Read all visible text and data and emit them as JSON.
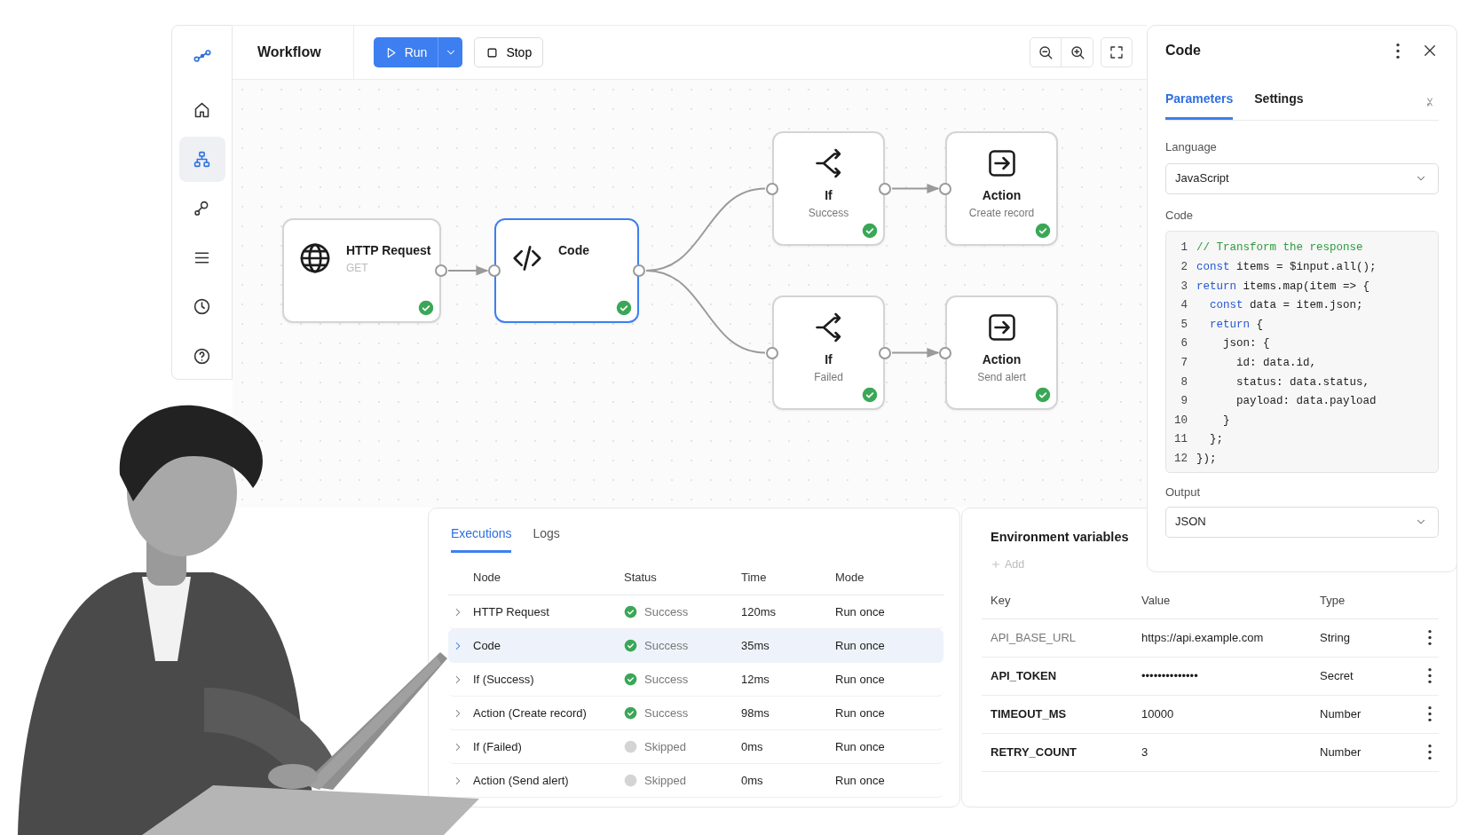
{
  "sidebar": {
    "items": [
      {
        "selected": false
      },
      {
        "selected": true
      },
      {
        "selected": false
      },
      {
        "selected": false
      },
      {
        "selected": false
      },
      {
        "selected": false
      }
    ]
  },
  "toolbar": {
    "title": "Workflow",
    "run_button": "Run",
    "stop_button": "Stop"
  },
  "canvas": {
    "nodes": [
      {
        "kind": "http",
        "title": "HTTP Request",
        "subtitle": "GET",
        "selected": false,
        "succeeded": true
      },
      {
        "kind": "code",
        "title": "Code",
        "selected": true,
        "succeeded": true
      },
      {
        "kind": "if",
        "title": "If",
        "subtitle": "Success",
        "selected": false,
        "succeeded": true
      },
      {
        "kind": "action",
        "title": "Action",
        "subtitle": "Create record",
        "selected": false,
        "succeeded": true
      },
      {
        "kind": "if",
        "title": "If",
        "subtitle": "Failed",
        "selected": false,
        "succeeded": true
      },
      {
        "kind": "action",
        "title": "Action",
        "subtitle": "Send alert",
        "selected": false,
        "succeeded": true
      }
    ]
  },
  "panel": {
    "title": "Code",
    "tabs": [
      {
        "label": "Parameters",
        "selected": true
      },
      {
        "label": "Settings",
        "selected": false
      }
    ],
    "language_label": "Language",
    "language": "JavaScript",
    "code_label": "Code",
    "code_lines": [
      {
        "number": "1",
        "tokens": [
          {
            "kind": "comment",
            "text": "// Transform the response"
          }
        ]
      },
      {
        "number": "2",
        "tokens": [
          {
            "kind": "keyword",
            "text": "const"
          },
          {
            "kind": "plain",
            "text": " items = $input.all();"
          }
        ]
      },
      {
        "number": "3",
        "tokens": [
          {
            "kind": "keyword",
            "text": "return"
          },
          {
            "kind": "plain",
            "text": " items.map(item => {"
          }
        ]
      },
      {
        "number": "4",
        "tokens": [
          {
            "kind": "keyword",
            "text": "  const"
          },
          {
            "kind": "plain",
            "text": " data = item.json;"
          }
        ]
      },
      {
        "number": "5",
        "tokens": [
          {
            "kind": "keyword",
            "text": "  return"
          },
          {
            "kind": "plain",
            "text": " {"
          }
        ]
      },
      {
        "number": "6",
        "tokens": [
          {
            "kind": "plain",
            "text": "    json: {"
          }
        ]
      },
      {
        "number": "7",
        "tokens": [
          {
            "kind": "plain",
            "text": "      id: data.id,"
          }
        ]
      },
      {
        "number": "8",
        "tokens": [
          {
            "kind": "plain",
            "text": "      status: data.status,"
          }
        ]
      },
      {
        "number": "9",
        "tokens": [
          {
            "kind": "plain",
            "text": "      payload: data.payload"
          }
        ]
      },
      {
        "number": "10",
        "tokens": [
          {
            "kind": "plain",
            "text": "    }"
          }
        ]
      },
      {
        "number": "11",
        "tokens": [
          {
            "kind": "plain",
            "text": "  };"
          }
        ]
      },
      {
        "number": "12",
        "tokens": [
          {
            "kind": "plain",
            "text": "});"
          }
        ]
      }
    ],
    "output_label": "Output",
    "output": "JSON"
  },
  "executions": {
    "tabs": [
      {
        "label": "Executions",
        "selected": true
      },
      {
        "label": "Logs",
        "selected": false
      }
    ],
    "columns": [
      "Node",
      "Status",
      "Time",
      "Mode"
    ],
    "rows": [
      {
        "node": "HTTP Request",
        "skipped": false,
        "status": "Success",
        "time": "120ms",
        "mode": "Run once",
        "selected": false
      },
      {
        "node": "Code",
        "skipped": false,
        "status": "Success",
        "time": "35ms",
        "mode": "Run once",
        "selected": true
      },
      {
        "node": "If (Success)",
        "skipped": false,
        "status": "Success",
        "time": "12ms",
        "mode": "Run once",
        "selected": false
      },
      {
        "node": "Action (Create record)",
        "skipped": false,
        "status": "Success",
        "time": "98ms",
        "mode": "Run once",
        "selected": false
      },
      {
        "node": "If (Failed)",
        "skipped": true,
        "status": "Skipped",
        "time": "0ms",
        "mode": "Run once",
        "selected": false
      },
      {
        "node": "Action (Send alert)",
        "skipped": true,
        "status": "Skipped",
        "time": "0ms",
        "mode": "Run once",
        "selected": false
      }
    ]
  },
  "environment": {
    "title": "Environment variables",
    "add_button": "Add",
    "columns": [
      "Key",
      "Value",
      "Type"
    ],
    "rows": [
      {
        "key": "API_BASE_URL",
        "value": "https://api.example.com",
        "type": "String"
      },
      {
        "key": "API_TOKEN",
        "value": "••••••••••••••",
        "type": "Secret"
      },
      {
        "key": "TIMEOUT_MS",
        "value": "10000",
        "type": "Number"
      },
      {
        "key": "RETRY_COUNT",
        "value": "3",
        "type": "Number"
      }
    ]
  }
}
